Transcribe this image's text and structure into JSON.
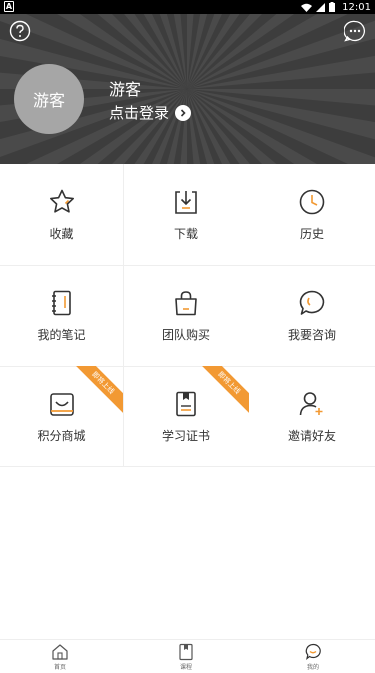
{
  "status_bar": {
    "time": "12:01",
    "app_indicator": "A"
  },
  "header": {
    "help_icon": "help-circle-icon",
    "more_icon": "chat-more-icon",
    "avatar_text": "游客",
    "username": "游客",
    "login_text": "点击登录",
    "login_arrow_icon": "chevron-right-icon"
  },
  "menu": {
    "items": [
      {
        "label": "收藏",
        "icon": "star-icon"
      },
      {
        "label": "下载",
        "icon": "download-icon"
      },
      {
        "label": "历史",
        "icon": "clock-icon"
      },
      {
        "label": "我的笔记",
        "icon": "notebook-icon"
      },
      {
        "label": "团队购买",
        "icon": "shopping-bag-icon"
      },
      {
        "label": "我要咨询",
        "icon": "chat-bubble-icon"
      },
      {
        "label": "积分商城",
        "icon": "points-mall-icon",
        "badge": "即将上线"
      },
      {
        "label": "学习证书",
        "icon": "certificate-icon",
        "badge": "即将上线"
      },
      {
        "label": "邀请好友",
        "icon": "invite-user-icon"
      }
    ]
  },
  "tabbar": {
    "tabs": [
      {
        "label": "首页",
        "icon": "home-icon"
      },
      {
        "label": "课程",
        "icon": "course-book-icon"
      },
      {
        "label": "我的",
        "icon": "profile-face-icon"
      }
    ]
  },
  "colors": {
    "accent": "#f29933",
    "header_bg": "#3d3d3d",
    "avatar_bg": "#a6a6a6"
  }
}
